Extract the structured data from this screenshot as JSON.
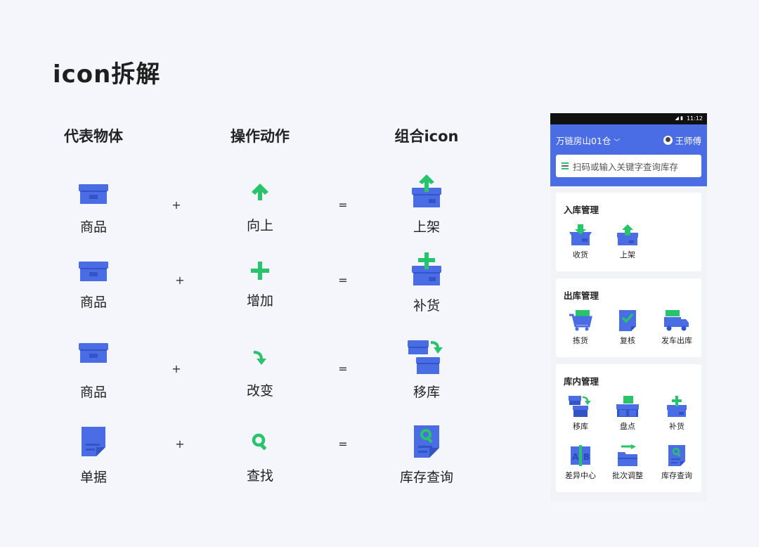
{
  "page": {
    "title": "icon拆解"
  },
  "columns": {
    "object": "代表物体",
    "action": "操作动作",
    "combined": "组合icon"
  },
  "operators": {
    "plus": "+",
    "equals": "="
  },
  "rows": [
    {
      "object": "商品",
      "action": "向上",
      "result": "上架"
    },
    {
      "object": "商品",
      "action": "增加",
      "result": "补货"
    },
    {
      "object": "商品",
      "action": "改变",
      "result": "移库"
    },
    {
      "object": "单据",
      "action": "查找",
      "result": "库存查询"
    }
  ],
  "phone": {
    "status_time": "11:12",
    "warehouse": "万链房山01仓",
    "user_name": "王师傅",
    "search_placeholder": "扫码或输入关键字查询库存",
    "sections": [
      {
        "title": "入库管理",
        "items": [
          "收货",
          "上架"
        ]
      },
      {
        "title": "出库管理",
        "items": [
          "拣货",
          "复核",
          "发车出库"
        ]
      },
      {
        "title": "库内管理",
        "items": [
          "移库",
          "盘点",
          "补货",
          "差异中心",
          "批次调整",
          "库存查询"
        ]
      }
    ]
  },
  "colors": {
    "primary": "#4a6de5",
    "accent": "#27c46b",
    "box_dark": "#3354c4"
  },
  "icons": {
    "box": "box-icon",
    "arrow_up": "arrow-up-icon",
    "plus": "plus-icon",
    "curve_arrow": "curved-arrow-icon",
    "magnifier": "magnifier-icon",
    "document": "document-icon"
  }
}
